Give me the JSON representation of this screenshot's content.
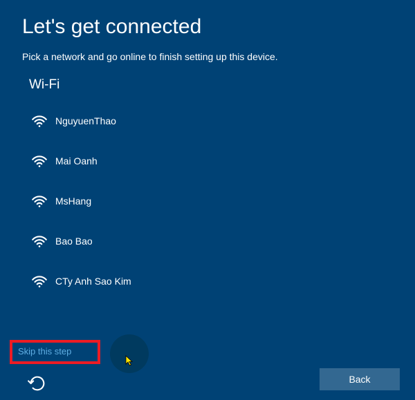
{
  "header": {
    "title": "Let's get connected",
    "subtitle": "Pick a network and go online to finish setting up this device."
  },
  "wifi": {
    "section_label": "Wi-Fi",
    "networks": [
      {
        "name": "NguyuenThao"
      },
      {
        "name": "Mai Oanh"
      },
      {
        "name": "MsHang"
      },
      {
        "name": "Bao Bao"
      },
      {
        "name": "CTy Anh Sao Kim"
      }
    ]
  },
  "actions": {
    "skip_label": "Skip this step",
    "back_label": "Back"
  }
}
